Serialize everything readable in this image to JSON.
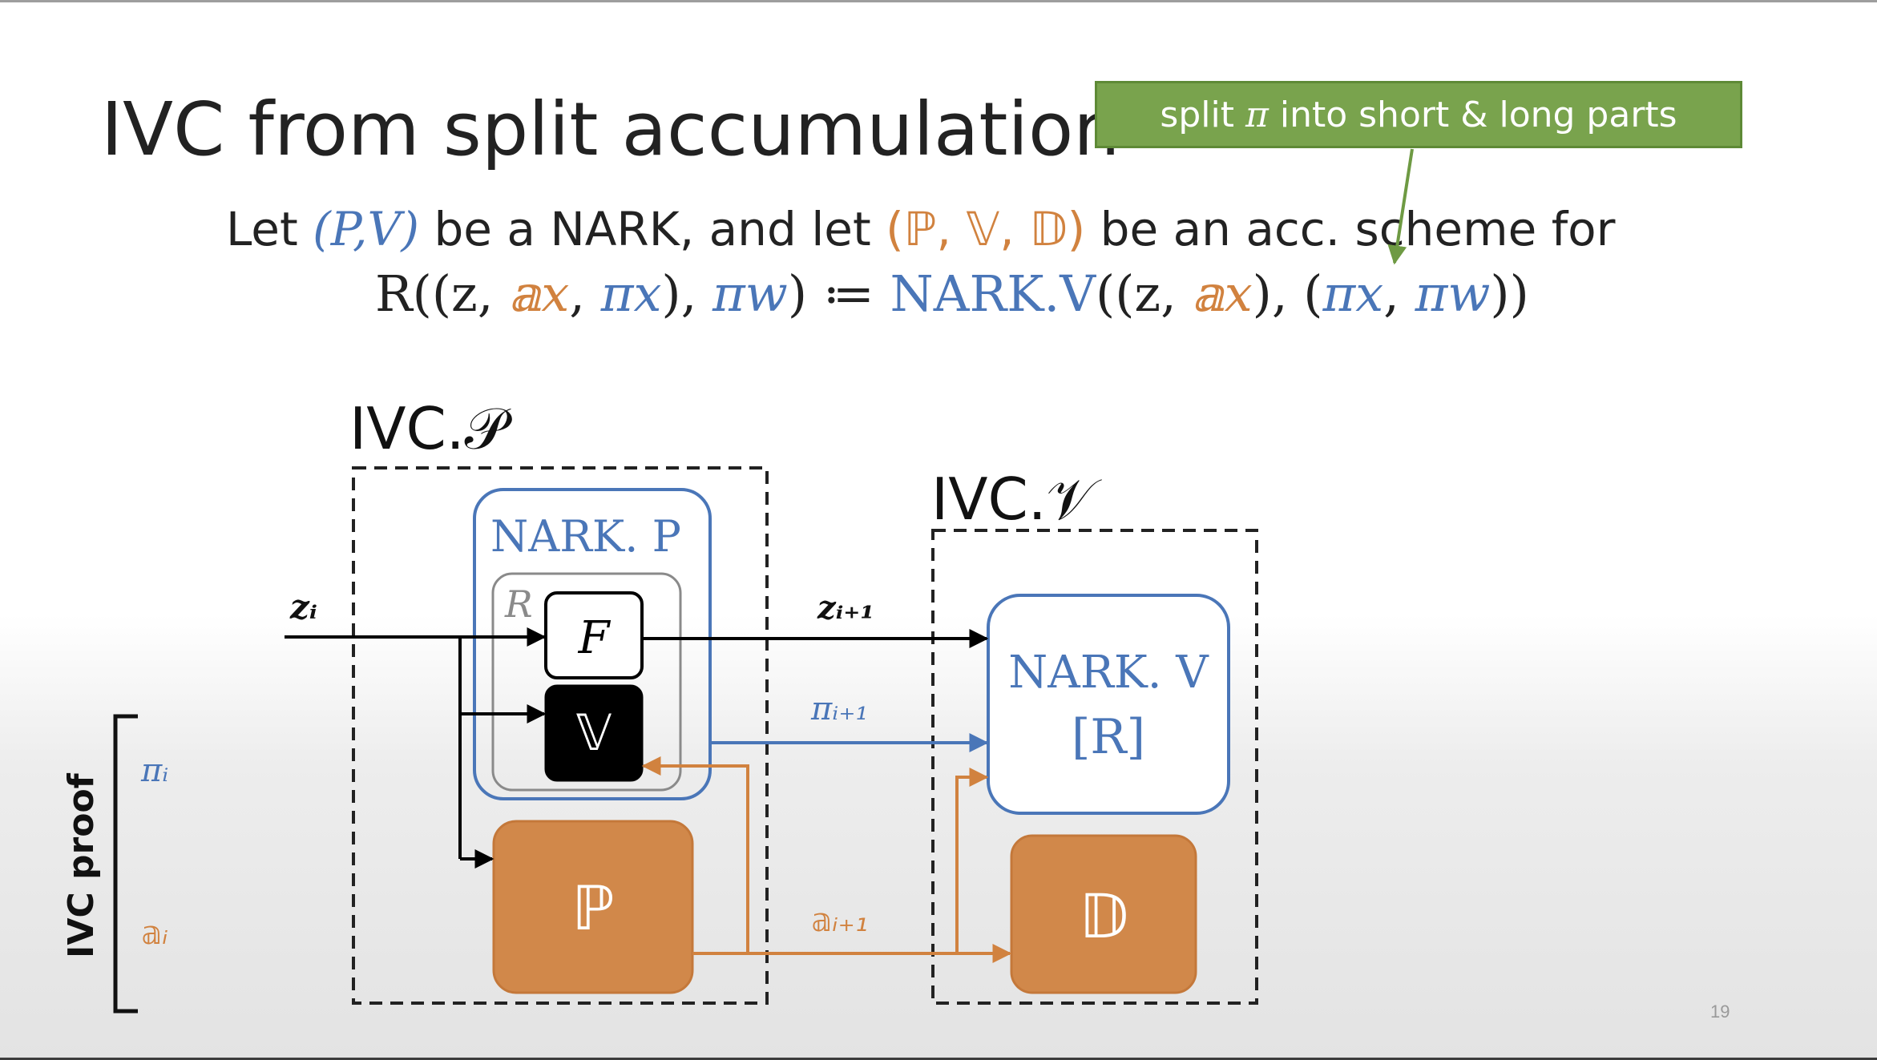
{
  "title": "IVC from split accumulation",
  "callout": {
    "prefix": "split ",
    "pi": "π",
    "suffix": " into short & long parts"
  },
  "statement": {
    "let": "Let ",
    "nark_pair": "(P,V)",
    "mid1": " be a NARK, and let ",
    "acc_triple": "(ℙ, 𝕍, 𝔻)",
    "mid2": " be an acc. scheme for",
    "relation_lhs": "R((z, ",
    "acc_x": "𝕒x",
    "comma1": ", ",
    "pi_x": "πx",
    "paren_close": "), ",
    "pi_w": "πw",
    "assign": ") ≔ ",
    "nark_v": "NARK.V",
    "rhs_open": "((z, ",
    "acc_x2": "𝕒x",
    "rhs_mid": "), (",
    "pi_x2": "πx",
    "comma2": ", ",
    "pi_w2": "πw",
    "rhs_close": "))"
  },
  "diagram": {
    "ivc_p_label": "IVC.𝒫",
    "ivc_v_label": "IVC.𝒱",
    "nark_p_label": "NARK. P",
    "r_label": "R",
    "f_label": "F",
    "v_box_label": "𝕍",
    "p_box_label": "ℙ",
    "d_box_label": "𝔻",
    "nark_v_label": "NARK. V",
    "nark_v_sub": "[R]",
    "z_i": "zᵢ",
    "z_next": "zᵢ₊₁",
    "pi_next": "πᵢ₊₁",
    "acc_next": "𝕒ᵢ₊₁",
    "proof_label": "IVC proof",
    "pi_i": "πᵢ",
    "acc_i": "𝕒ᵢ"
  },
  "page_number": "19",
  "colors": {
    "blue": "#4a76b8",
    "orange": "#d1823f",
    "orange_fill": "#d1884a",
    "green": "#79a34d",
    "black": "#000000"
  }
}
